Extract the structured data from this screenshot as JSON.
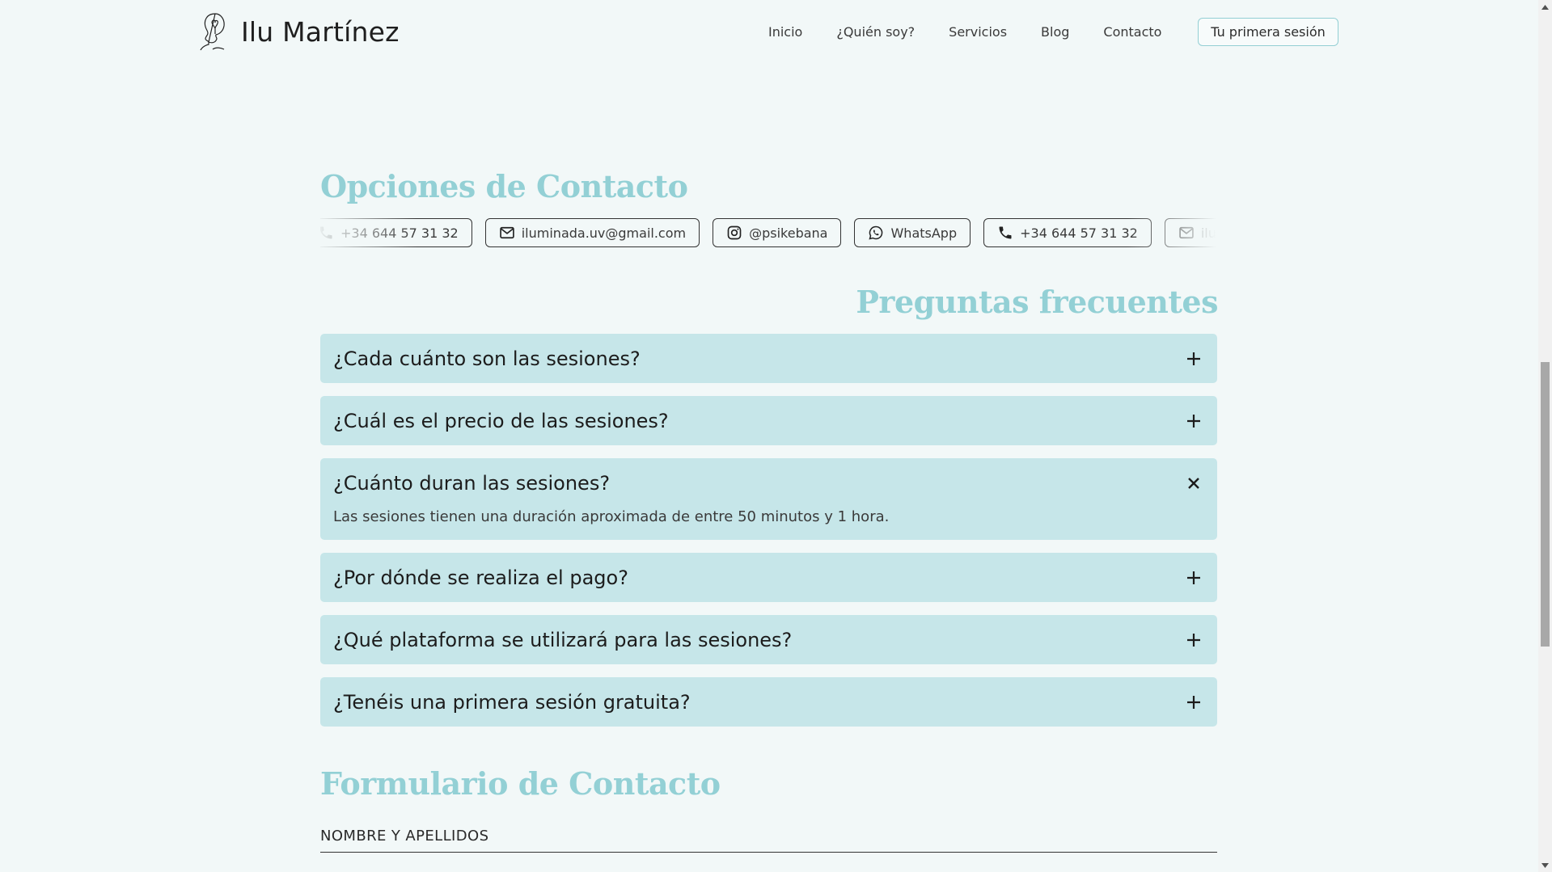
{
  "header": {
    "brand_name": "Ilu Martínez",
    "logo_icon": "woman-profile-heart-icon",
    "nav": [
      {
        "label": "Inicio"
      },
      {
        "label": "¿Quién soy?"
      },
      {
        "label": "Servicios"
      },
      {
        "label": "Blog"
      },
      {
        "label": "Contacto"
      }
    ],
    "cta_label": "Tu primera sesión",
    "accent_color": "#93cfd4"
  },
  "contact": {
    "title": "Opciones de Contacto",
    "chips": [
      {
        "icon": "phone-icon",
        "label": "+34 644 57 31 32"
      },
      {
        "icon": "mail-icon",
        "label": "iluminada.uv@gmail.com"
      },
      {
        "icon": "instagram-icon",
        "label": "@psikebana"
      },
      {
        "icon": "whatsapp-icon",
        "label": "WhatsApp"
      },
      {
        "icon": "phone-icon",
        "label": "+34 644 57 31 32"
      },
      {
        "icon": "mail-icon",
        "label": "ilum"
      }
    ]
  },
  "faq": {
    "title": "Preguntas frecuentes",
    "items": [
      {
        "question": "¿Cada cuánto son las sesiones?",
        "expanded": false,
        "toggle_icon": "plus-icon"
      },
      {
        "question": "¿Cuál es el precio de las sesiones?",
        "expanded": false,
        "toggle_icon": "plus-icon"
      },
      {
        "question": "¿Cuánto duran las sesiones?",
        "expanded": true,
        "toggle_icon": "close-icon",
        "answer": "Las sesiones tienen una duración aproximada de entre 50 minutos y 1 hora."
      },
      {
        "question": "¿Por dónde se realiza el pago?",
        "expanded": false,
        "toggle_icon": "plus-icon"
      },
      {
        "question": "¿Qué plataforma se utilizará para las sesiones?",
        "expanded": false,
        "toggle_icon": "plus-icon"
      },
      {
        "question": "¿Tenéis una primera sesión gratuita?",
        "expanded": false,
        "toggle_icon": "plus-icon"
      }
    ],
    "panel_color": "#c6e6e9"
  },
  "form": {
    "title": "Formulario de Contacto",
    "name_label": "NOMBRE Y APELLIDOS"
  },
  "colors": {
    "background": "#f2f8f8",
    "heading": "#93d0d5"
  }
}
